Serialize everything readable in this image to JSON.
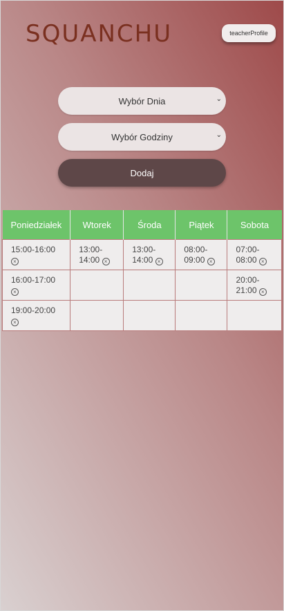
{
  "header": {
    "logo": "SQUANCHU",
    "profile_button": "teacherProfile"
  },
  "form": {
    "day_select": "Wybór Dnia",
    "hour_select": "Wybór Godziny",
    "add_button": "Dodaj"
  },
  "schedule": {
    "columns": [
      "Poniedziałek",
      "Wtorek",
      "Środa",
      "Piątek",
      "Sobota"
    ],
    "rows": [
      [
        "15:00-16:00",
        "13:00-14:00",
        "13:00-14:00",
        "08:00-09:00",
        "07:00-08:00"
      ],
      [
        "16:00-17:00",
        "",
        "",
        "",
        "20:00-21:00"
      ],
      [
        "19:00-20:00",
        "",
        "",
        "",
        ""
      ]
    ]
  },
  "icons": {
    "remove": "close-circle-icon",
    "dropdown": "chevron-down-icon"
  }
}
